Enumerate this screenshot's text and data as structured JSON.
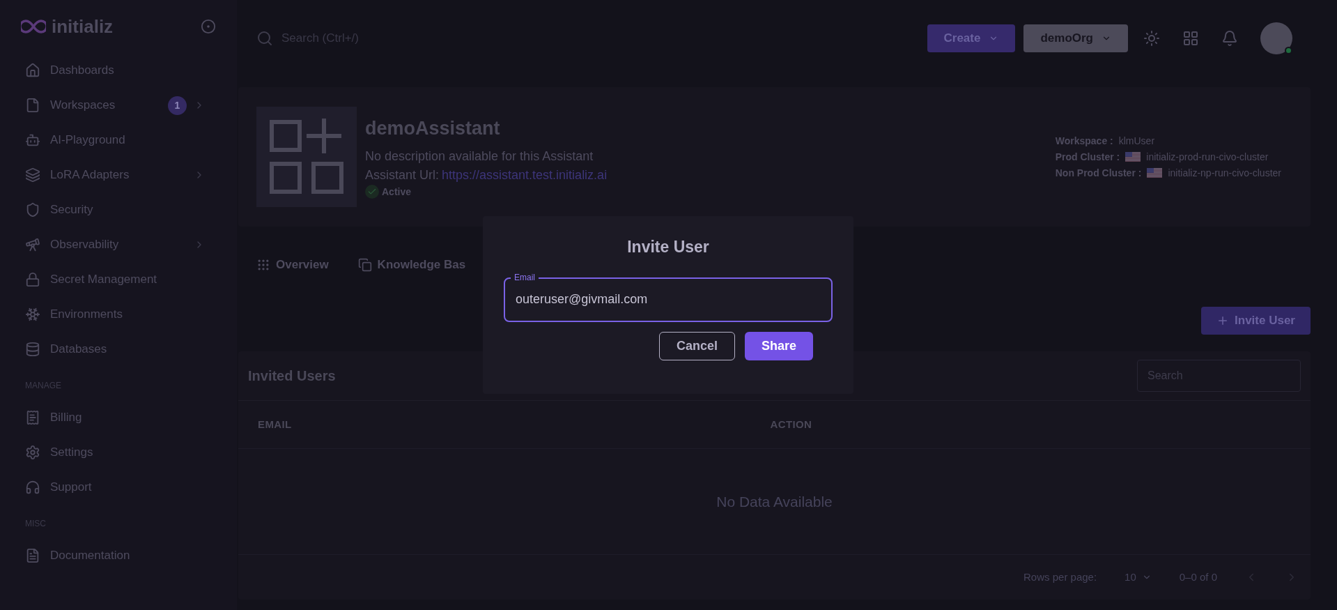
{
  "brand": {
    "name": "initializ"
  },
  "sidebar": {
    "items": [
      {
        "kind": "item",
        "label": "Dashboards",
        "expandable": false
      },
      {
        "kind": "item",
        "label": "Workspaces",
        "badge": "1",
        "expandable": true
      },
      {
        "kind": "item",
        "label": "AI-Playground",
        "expandable": false
      },
      {
        "kind": "item",
        "label": "LoRA Adapters",
        "expandable": true
      },
      {
        "kind": "item",
        "label": "Security",
        "expandable": false
      },
      {
        "kind": "item",
        "label": "Observability",
        "expandable": true
      },
      {
        "kind": "item",
        "label": "Secret Management",
        "expandable": false
      },
      {
        "kind": "item",
        "label": "Environments",
        "expandable": false
      },
      {
        "kind": "item",
        "label": "Databases",
        "expandable": false
      },
      {
        "kind": "section",
        "label": "MANAGE"
      },
      {
        "kind": "item",
        "label": "Billing",
        "expandable": false
      },
      {
        "kind": "item",
        "label": "Settings",
        "expandable": false
      },
      {
        "kind": "item",
        "label": "Support",
        "expandable": false
      },
      {
        "kind": "section",
        "label": "MISC"
      },
      {
        "kind": "item",
        "label": "Documentation",
        "expandable": false
      }
    ]
  },
  "topbar": {
    "search": {
      "placeholder": "Search (Ctrl+/)"
    },
    "create_button": "Create",
    "org_button": "demoOrg"
  },
  "assistant": {
    "name": "demoAssistant",
    "description": "No description available for this Assistant",
    "url_label": "Assistant Url:",
    "url": "https://assistant.test.initializ.ai",
    "status": "Active",
    "meta": [
      {
        "kind": "plain",
        "label": "Workspace :",
        "value": "klmUser"
      },
      {
        "kind": "cluster",
        "label": "Prod Cluster :",
        "value": "initializ-prod-run-civo-cluster"
      },
      {
        "kind": "cluster",
        "label": "Non Prod Cluster :",
        "value": "initializ-np-run-civo-cluster"
      }
    ]
  },
  "tabs": [
    {
      "label": "Overview",
      "selected": false
    },
    {
      "label": "Knowledge Bas",
      "selected": false
    }
  ],
  "invite_button": "Invite User",
  "invited_users": {
    "title": "Invited Users",
    "search": {
      "placeholder": "Search"
    },
    "columns": [
      "EMAIL",
      "ACTION"
    ],
    "empty": "No Data Available",
    "pagination": {
      "rows_label": "Rows per page:",
      "rows_value": "10",
      "range": "0–0 of 0"
    }
  },
  "dialog": {
    "title": "Invite User",
    "field": {
      "label": "Email",
      "value": "outeruser@givmail.com"
    },
    "buttons": [
      {
        "kind": "outline",
        "label": "Cancel"
      },
      {
        "kind": "primary",
        "label": "Share"
      }
    ]
  }
}
